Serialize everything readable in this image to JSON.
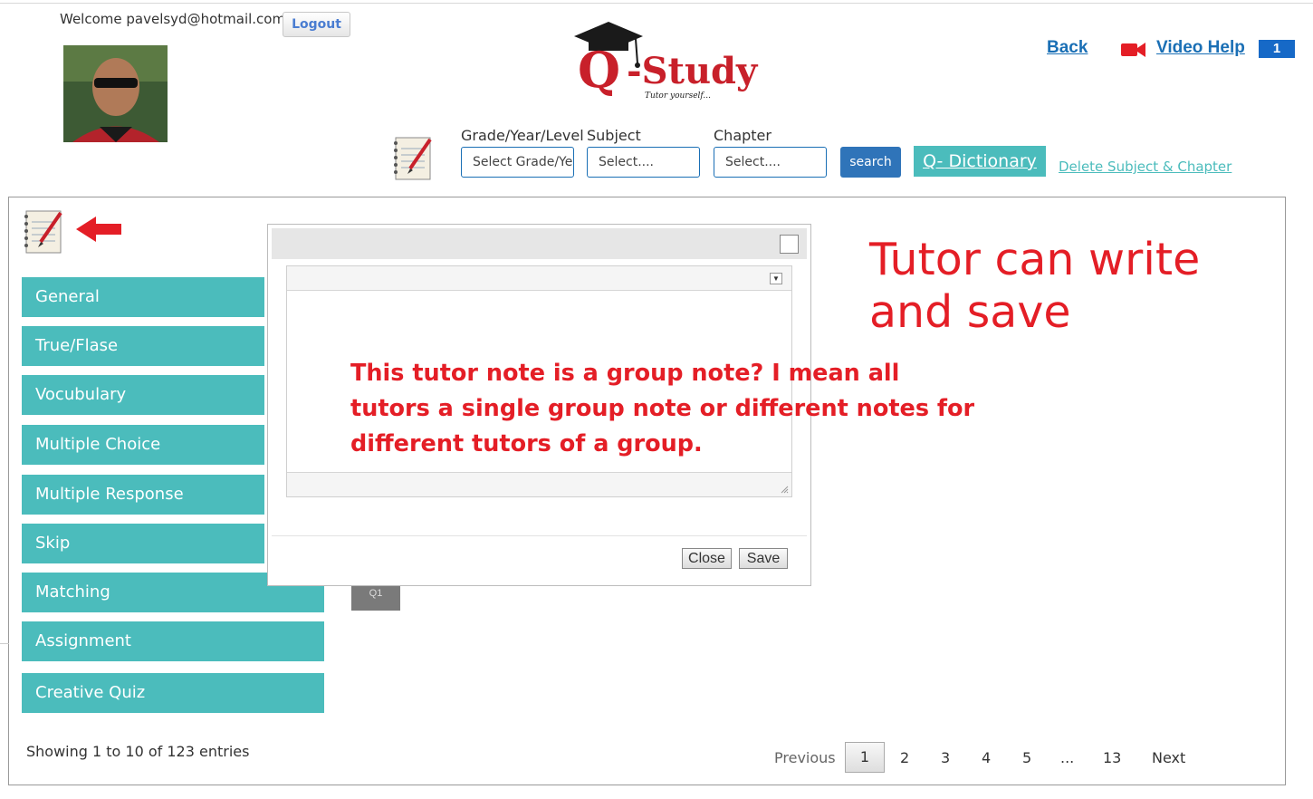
{
  "header": {
    "welcome": "Welcome pavelsyd@hotmail.com",
    "logout_label": "Logout",
    "logo_text": "Q-Study",
    "logo_tagline": "Tutor yourself...",
    "back_label": "Back",
    "video_help_label": "Video Help",
    "video_help_badge": "1"
  },
  "filters": {
    "grade_label": "Grade/Year/Level",
    "grade_value": "Select Grade/Ye",
    "subject_label": "Subject",
    "subject_value": "Select....",
    "chapter_label": "Chapter",
    "chapter_value": "Select....",
    "search_label": "search",
    "qdict_label": "Q- Dictionary",
    "delete_label": "Delete Subject & Chapter"
  },
  "menu": {
    "items": [
      "General",
      "True/Flase",
      "Vocubulary",
      "Multiple Choice",
      "Multiple Response",
      "Skip",
      "Matching",
      "Assignment",
      "Creative Quiz"
    ]
  },
  "q1_label": "Q1",
  "dialog": {
    "close_label": "Close",
    "save_label": "Save"
  },
  "annotations": {
    "big": "Tutor can write and save",
    "question": "This tutor note is a group note? I mean all tutors a single group note or different notes for different tutors of a group."
  },
  "pagination": {
    "showing": "Showing 1 to 10 of 123 entries",
    "previous": "Previous",
    "pages": [
      "1",
      "2",
      "3",
      "4",
      "5",
      "...",
      "13"
    ],
    "next": "Next"
  },
  "colors": {
    "teal": "#4bbcbc",
    "link_blue": "#1a6fb5",
    "annotation_red": "#e41e26",
    "search_blue": "#2f74b9"
  }
}
